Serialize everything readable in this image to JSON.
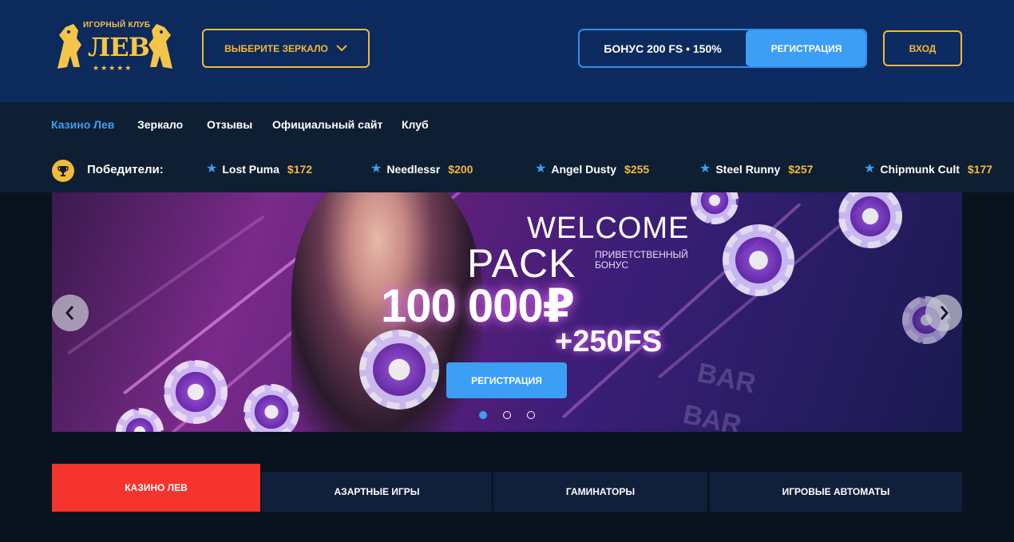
{
  "header": {
    "logo": {
      "club_label": "ИГОРНЫЙ КЛУБ",
      "name": "ЛЕВ",
      "stars": "★★★★★"
    },
    "mirror_button": {
      "label": "ВЫБЕРИТЕ ЗЕРКАЛО",
      "icon": "chevron-down-icon"
    },
    "bonus": {
      "text": "БОНУС 200 FS • 150%",
      "register_label": "РЕГИСТРАЦИЯ"
    },
    "login_label": "ВХОД"
  },
  "nav": {
    "items": [
      {
        "label": "Казино Лев",
        "active": true
      },
      {
        "label": "Зеркало",
        "active": false
      },
      {
        "label": "Отзывы",
        "active": false
      },
      {
        "label": "Официальный сайт",
        "active": false
      },
      {
        "label": "Клуб",
        "active": false
      }
    ]
  },
  "winners": {
    "label": "Победители:",
    "icon": "trophy-icon",
    "list": [
      {
        "name": "Lost Puma",
        "amount": "$172"
      },
      {
        "name": "Needlessr",
        "amount": "$200"
      },
      {
        "name": "Angel Dusty",
        "amount": "$255"
      },
      {
        "name": "Steel Runny",
        "amount": "$257"
      },
      {
        "name": "Chipmunk Cult",
        "amount": "$177"
      }
    ]
  },
  "banner": {
    "welcome": "WELCOME",
    "pack": "PACK",
    "pack_subtitle": "ПРИВЕТСТВЕННЫЙ БОНУС",
    "amount": "100 000₽",
    "free_spins": "+250FS",
    "slot_text": "BAR",
    "register_label": "РЕГИСТРАЦИЯ",
    "slides_total": 3,
    "active_slide": 1
  },
  "tabs": [
    {
      "label": "КАЗИНО ЛЕВ",
      "active": true
    },
    {
      "label": "АЗАРТНЫЕ ИГРЫ",
      "active": false
    },
    {
      "label": "ГАМИНАТОРЫ",
      "active": false
    },
    {
      "label": "ИГРОВЫЕ АВТОМАТЫ",
      "active": false
    }
  ],
  "colors": {
    "header_bg": "#0c2a5e",
    "nav_bg": "#0e1e33",
    "gold": "#f2b93b",
    "accent_blue": "#3c9ef5",
    "active_tab_red": "#f5342d"
  }
}
